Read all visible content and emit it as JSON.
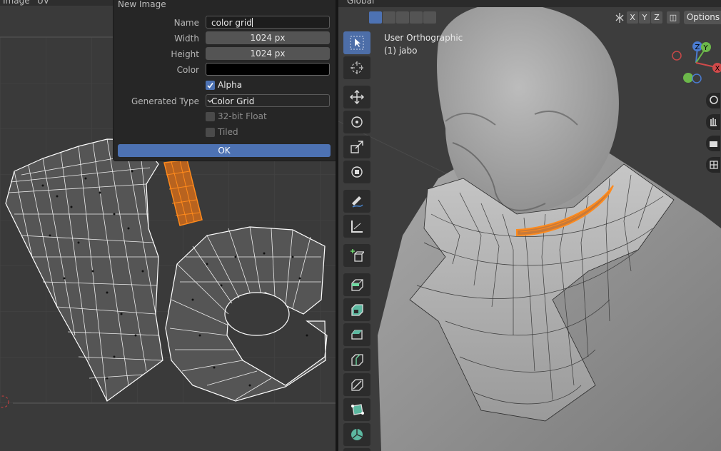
{
  "uv_editor": {
    "header_mode": "Image",
    "header_menu": "UV"
  },
  "dialog": {
    "title": "New Image",
    "name_label": "Name",
    "name_value": "color grid",
    "width_label": "Width",
    "width_value": "1024 px",
    "height_label": "Height",
    "height_value": "1024 px",
    "color_label": "Color",
    "color_value": "#000000",
    "alpha_label": "Alpha",
    "alpha_checked": true,
    "generated_type_label": "Generated Type",
    "generated_type_value": "Color Grid",
    "float_label": "32-bit Float",
    "float_checked": false,
    "tiled_label": "Tiled",
    "tiled_checked": false,
    "ok_label": "OK"
  },
  "viewport": {
    "header_orientation": "Global",
    "view_name": "User Orthographic",
    "object_name": "(1) jabo",
    "axis_x": "X",
    "axis_y": "Y",
    "axis_z": "Z",
    "options_label": "Options"
  },
  "gizmo": {
    "z_label": "Z",
    "y_label": "Y",
    "x_label": "X"
  },
  "toolbar": {
    "tools": [
      "select-box",
      "cursor",
      "move",
      "rotate",
      "scale",
      "transform",
      "annotate",
      "measure",
      "add-cube",
      "extrude-region",
      "inset-faces",
      "bevel",
      "loop-cut",
      "knife",
      "poly-build",
      "spin"
    ]
  },
  "colors": {
    "accent": "#4d72b3",
    "selection_orange": "#ff8a1c"
  }
}
